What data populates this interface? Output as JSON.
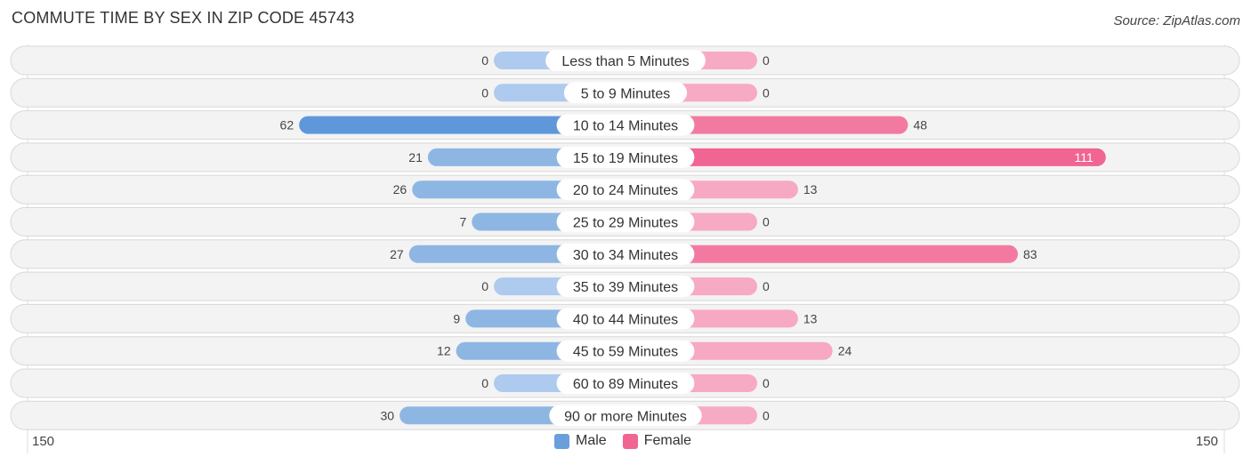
{
  "chart_data": {
    "type": "bar",
    "orientation": "horizontal-diverging",
    "title": "COMMUTE TIME BY SEX IN ZIP CODE 45743",
    "source": "Source: ZipAtlas.com",
    "categories": [
      "Less than 5 Minutes",
      "5 to 9 Minutes",
      "10 to 14 Minutes",
      "15 to 19 Minutes",
      "20 to 24 Minutes",
      "25 to 29 Minutes",
      "30 to 34 Minutes",
      "35 to 39 Minutes",
      "40 to 44 Minutes",
      "45 to 59 Minutes",
      "60 to 89 Minutes",
      "90 or more Minutes"
    ],
    "series": [
      {
        "name": "Male",
        "color": "#6a9fdc",
        "values": [
          0,
          0,
          62,
          21,
          26,
          7,
          27,
          0,
          9,
          12,
          0,
          30
        ]
      },
      {
        "name": "Female",
        "color": "#f06592",
        "values": [
          0,
          0,
          48,
          111,
          13,
          0,
          83,
          0,
          13,
          24,
          0,
          0
        ]
      }
    ],
    "axis": {
      "left_label": "150",
      "right_label": "150",
      "range": [
        150,
        150
      ]
    },
    "legend": {
      "placement": "bottom-center",
      "items": [
        "Male",
        "Female"
      ]
    }
  }
}
